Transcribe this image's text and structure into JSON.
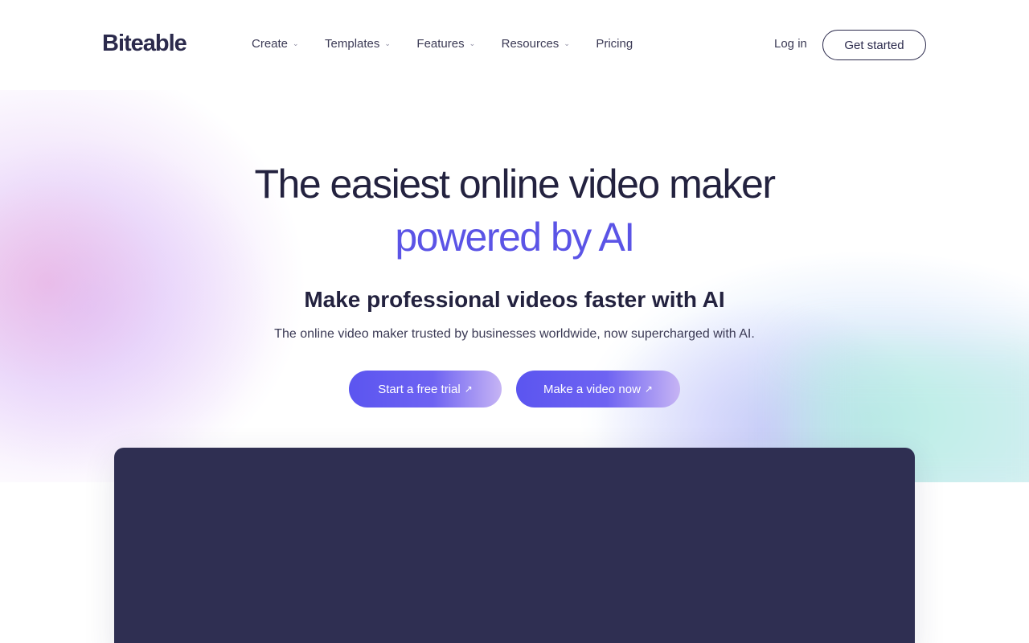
{
  "brand": {
    "logo_text": "Biteable"
  },
  "nav": {
    "items": [
      {
        "label": "Create",
        "has_dropdown": true
      },
      {
        "label": "Templates",
        "has_dropdown": true
      },
      {
        "label": "Features",
        "has_dropdown": true
      },
      {
        "label": "Resources",
        "has_dropdown": true
      },
      {
        "label": "Pricing",
        "has_dropdown": false
      }
    ],
    "login_label": "Log in",
    "get_started_label": "Get started"
  },
  "hero": {
    "title_line1": "The easiest online video maker",
    "title_line2": "powered by AI",
    "subtitle": "Make professional videos faster with AI",
    "description": "The online video maker trusted by businesses worldwide, now supercharged with AI.",
    "primary_cta": "Start a free trial",
    "secondary_cta": "Make a video now",
    "cta_icon": "arrow-up-right-icon"
  },
  "colors": {
    "brand_dark": "#23223f",
    "accent_purple": "#5b54e6",
    "video_panel": "#2f2f52"
  }
}
